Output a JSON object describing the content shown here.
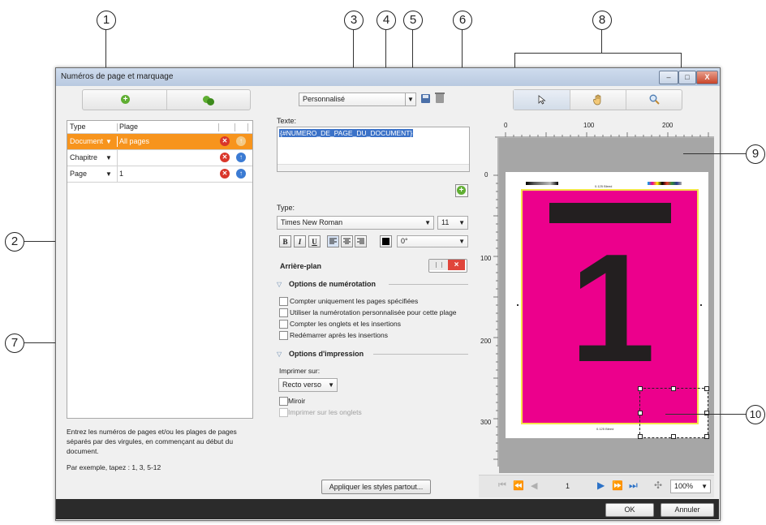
{
  "callouts": [
    "1",
    "2",
    "3",
    "4",
    "5",
    "6",
    "7",
    "8",
    "9",
    "10"
  ],
  "window": {
    "title": "Numéros de page et marquage",
    "controls": {
      "minimize": "–",
      "maximize": "□",
      "close": "X"
    }
  },
  "toolbar_left": {
    "add_icon": "add-icon",
    "copy_icon": "duplicate-icon"
  },
  "table": {
    "headers": [
      "Type",
      "Plage"
    ],
    "rows": [
      {
        "type": "Document",
        "range": "All pages",
        "selected": true
      },
      {
        "type": "Chapitre",
        "range": "",
        "selected": false
      },
      {
        "type": "Page",
        "range": "1",
        "selected": false
      }
    ]
  },
  "help": {
    "line1": "Entrez les numéros de pages et/ou les plages de pages",
    "line2": "séparés par des virgules, en commençant au début du",
    "line3": "document.",
    "example": "Par exemple, tapez : 1, 3, 5-12"
  },
  "preset": {
    "value": "Personnalisé"
  },
  "text_field": {
    "label": "Texte:",
    "value": "{#NUMERO_DE_PAGE_DU_DOCUMENT}"
  },
  "font": {
    "label": "Type:",
    "family": "Times New Roman",
    "size": "11",
    "bold": "B",
    "italic": "I",
    "underline": "U",
    "rotation": "0°"
  },
  "background": {
    "label": "Arrière-plan"
  },
  "numbering": {
    "title": "Options de numérotation",
    "options": [
      "Compter uniquement les pages spécifiées",
      "Utiliser la numérotation personnalisée pour cette plage",
      "Compter les onglets et les insertions",
      "Redémarrer après les insertions"
    ]
  },
  "printing": {
    "title": "Options d'impression",
    "print_on_label": "Imprimer sur:",
    "print_on_value": "Recto verso",
    "mirror": "Miroir",
    "tabs": "Imprimer sur les onglets"
  },
  "apply_button": "Appliquer les styles partout...",
  "preview": {
    "ruler_x": [
      "0",
      "100",
      "200"
    ],
    "ruler_y": [
      "0",
      "100",
      "200",
      "300"
    ],
    "page_number": "1",
    "marker_text": "0.125 Bleed",
    "page_color": "#ec008c"
  },
  "nav": {
    "current_page": "1",
    "zoom": "100%"
  },
  "footer": {
    "ok": "OK",
    "cancel": "Annuler"
  }
}
